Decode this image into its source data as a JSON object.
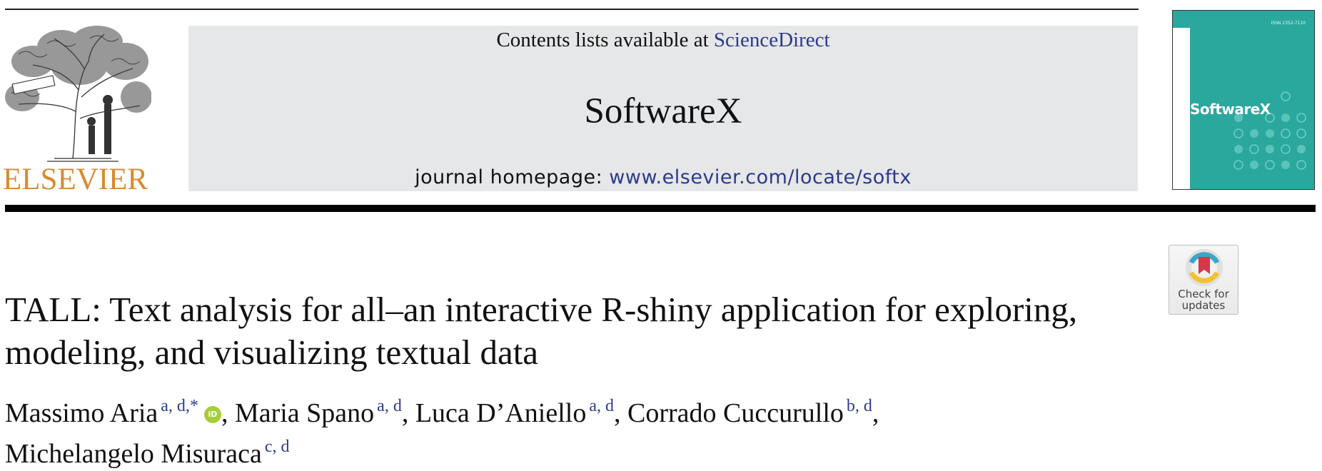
{
  "header": {
    "contents_prefix": "Contents lists available at ",
    "contents_link": "ScienceDirect",
    "journal_title": "SoftwareX",
    "homepage_prefix": "journal homepage: ",
    "homepage_url": "www.elsevier.com/locate/softx"
  },
  "publisher": {
    "wordmark": "ELSEVIER",
    "motto": "NON SOLUS"
  },
  "cover": {
    "title": "SoftwareX",
    "issn": "ISSN 2352-7110",
    "color": "#2aa89e"
  },
  "badge": {
    "label_line1": "Check for",
    "label_line2": "updates"
  },
  "article": {
    "title_line1": "TALL: Text analysis for all–an interactive R-shiny application for exploring,",
    "title_line2": "modeling, and visualizing textual data"
  },
  "authors": [
    {
      "name": "Massimo Aria",
      "aff": "a, d,",
      "mark": "*",
      "orcid": "iD"
    },
    {
      "name": "Maria Spano",
      "aff": "a, d"
    },
    {
      "name": "Luca D’Aniello",
      "aff": "a, d"
    },
    {
      "name": "Corrado Cuccurullo",
      "aff": "b, d"
    },
    {
      "name": "Michelangelo Misuraca",
      "aff": "c, d"
    }
  ],
  "colors": {
    "link": "#2c3a8c",
    "elsevier_orange": "#d98a2f",
    "masthead_grey": "#e6e7e8",
    "orcid_green": "#a6ce39"
  }
}
